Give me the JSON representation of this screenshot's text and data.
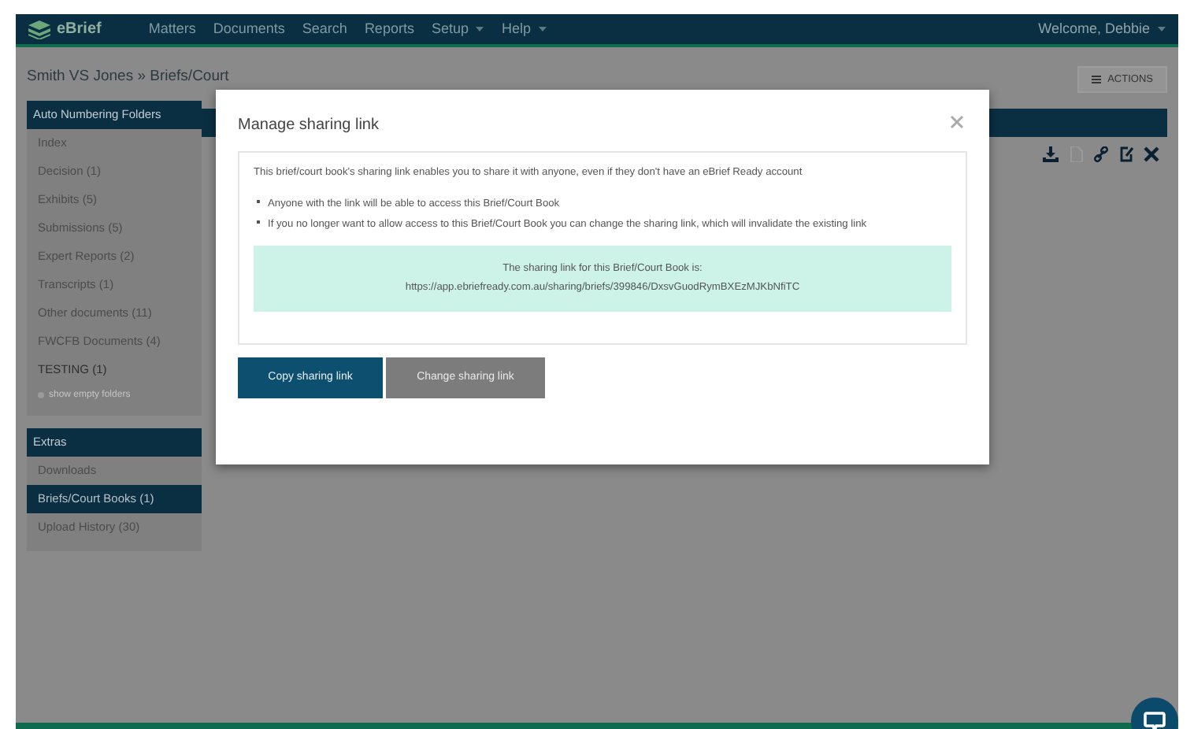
{
  "navbar": {
    "logo": "eBrief",
    "items": [
      {
        "label": "Matters",
        "dropdown": false
      },
      {
        "label": "Documents",
        "dropdown": false
      },
      {
        "label": "Search",
        "dropdown": false
      },
      {
        "label": "Reports",
        "dropdown": false
      },
      {
        "label": "Setup",
        "dropdown": true
      },
      {
        "label": "Help",
        "dropdown": true
      }
    ],
    "user": {
      "label": "Welcome, Debbie",
      "dropdown": true
    }
  },
  "breadcrumb": "Smith VS Jones » Briefs/Court",
  "actions_button": "ACTIONS",
  "sidebar": [
    {
      "title": "Auto Numbering Folders",
      "items": [
        {
          "label": "Index",
          "selected": false,
          "kind": "folder"
        },
        {
          "label": "Decision (1)",
          "selected": false,
          "kind": "folder"
        },
        {
          "label": "Exhibits (5)",
          "selected": false,
          "kind": "folder"
        },
        {
          "label": "Submissions (5)",
          "selected": false,
          "kind": "folder"
        },
        {
          "label": "Expert Reports (2)",
          "selected": false,
          "kind": "folder"
        },
        {
          "label": "Transcripts (1)",
          "selected": false,
          "kind": "folder"
        },
        {
          "label": "Other documents (11)",
          "selected": false,
          "kind": "folder"
        },
        {
          "label": "FWCFB Documents (4)",
          "selected": false,
          "kind": "folder"
        },
        {
          "label": "TESTING (1)",
          "selected": false,
          "kind": "custom"
        },
        {
          "label": "show empty folders",
          "selected": false,
          "kind": "toggle"
        }
      ]
    },
    {
      "title": "Extras",
      "items": [
        {
          "label": "Downloads",
          "selected": false,
          "kind": "folder"
        },
        {
          "label": "Briefs/Court Books (1)",
          "selected": true,
          "kind": "folder"
        },
        {
          "label": "Upload History (30)",
          "selected": false,
          "kind": "folder"
        }
      ]
    }
  ],
  "toolbar": [
    {
      "kind": "download",
      "disabled": false
    },
    {
      "kind": "file",
      "disabled": true
    },
    {
      "kind": "link",
      "disabled": false
    },
    {
      "kind": "edit",
      "disabled": false
    },
    {
      "kind": "delete",
      "disabled": false
    }
  ],
  "modal": {
    "title": "Manage sharing link",
    "intro": "This brief/court book's sharing link enables you to share it with anyone, even if they don't have an eBrief Ready account",
    "bullets": [
      "Anyone with the link will be able to access this Brief/Court Book",
      "If you no longer want to allow access to this Brief/Court Book you can change the sharing link, which will invalidate the existing link"
    ],
    "link_label": "The sharing link for this Brief/Court Book is:",
    "link_url": "https://app.ebriefready.com.au/sharing/briefs/399846/DxsvGuodRymBXEzMJKbNfiTC",
    "buttons": [
      {
        "label": "Copy sharing link",
        "kind": "primary"
      },
      {
        "label": "Change sharing link",
        "kind": "secondary"
      }
    ]
  }
}
